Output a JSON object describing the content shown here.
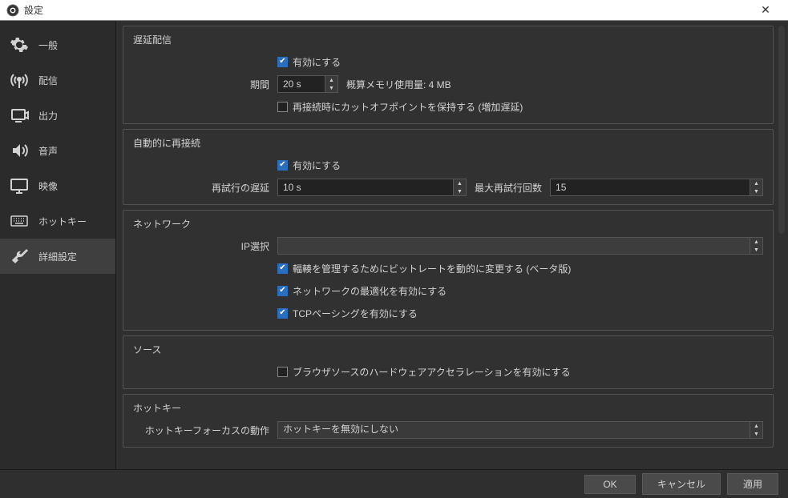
{
  "window": {
    "title": "設定"
  },
  "sidebar": {
    "items": [
      {
        "label": "一般"
      },
      {
        "label": "配信"
      },
      {
        "label": "出力"
      },
      {
        "label": "音声"
      },
      {
        "label": "映像"
      },
      {
        "label": "ホットキー"
      },
      {
        "label": "詳細設定"
      }
    ]
  },
  "sections": {
    "delay": {
      "title": "遅延配信",
      "enable": "有効にする",
      "period_label": "期間",
      "period_value": "20 s",
      "mem_label": "概算メモリ使用量: 4 MB",
      "preserve": "再接続時にカットオフポイントを保持する (増加遅延)"
    },
    "reconnect": {
      "title": "自動的に再接続",
      "enable": "有効にする",
      "retry_delay_label": "再試行の遅延",
      "retry_delay_value": "10 s",
      "max_retry_label": "最大再試行回数",
      "max_retry_value": "15"
    },
    "network": {
      "title": "ネットワーク",
      "ip_label": "IP選択",
      "ip_value": "",
      "opt1": "輻輳を管理するためにビットレートを動的に変更する (ベータ版)",
      "opt2": "ネットワークの最適化を有効にする",
      "opt3": "TCPペーシングを有効にする"
    },
    "source": {
      "title": "ソース",
      "hwaccel": "ブラウザソースのハードウェアアクセラレーションを有効にする"
    },
    "hotkey": {
      "title": "ホットキー",
      "focus_label": "ホットキーフォーカスの動作",
      "focus_value": "ホットキーを無効にしない"
    }
  },
  "footer": {
    "ok": "OK",
    "cancel": "キャンセル",
    "apply": "適用"
  }
}
